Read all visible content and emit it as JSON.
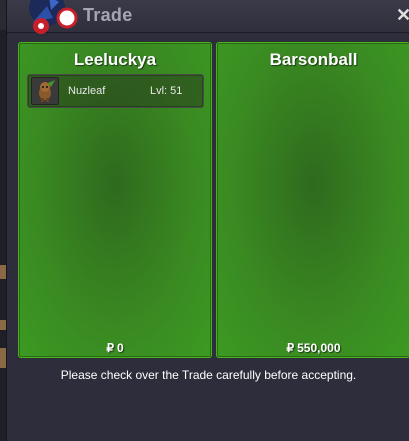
{
  "window": {
    "title": "Trade",
    "close_glyph": "✕"
  },
  "left_trader": {
    "name": "Leeluckya",
    "pokemon": [
      {
        "name": "Nuzleaf",
        "level": "Lvl: 51",
        "icon": "nuzleaf-sprite-icon"
      }
    ],
    "currency_symbol": "₽",
    "money": "0"
  },
  "right_trader": {
    "name": "Barsonball",
    "pokemon": [],
    "currency_symbol": "₽",
    "money": "550,000"
  },
  "footer": {
    "notice": "Please check over the Trade carefully before accepting."
  },
  "colors": {
    "panel_green": "#3a8a22",
    "panel_border": "#46b21c",
    "window_bg": "#2e2d3b"
  }
}
